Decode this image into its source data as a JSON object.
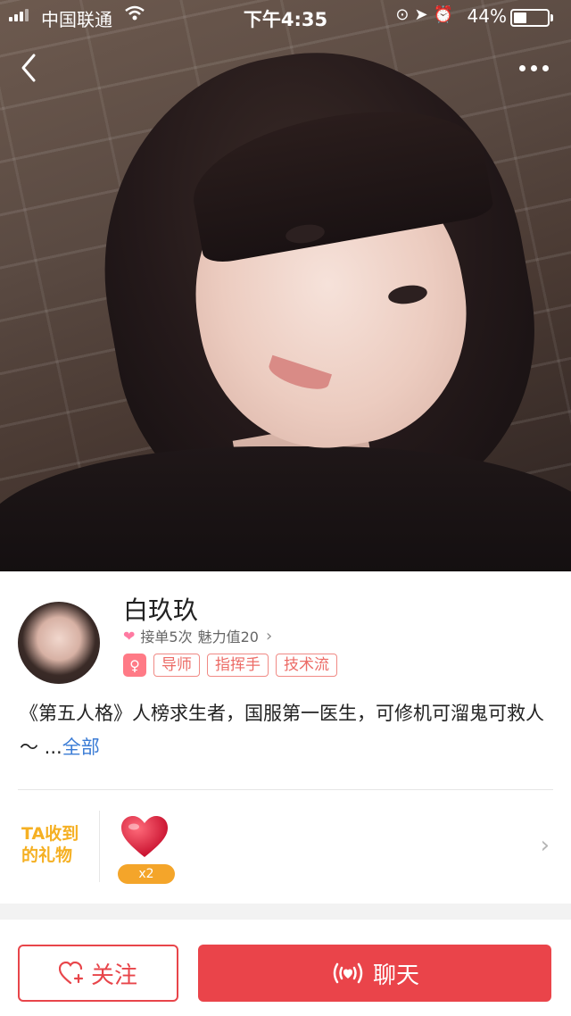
{
  "status_bar": {
    "carrier": "中国联通",
    "time": "下午4:35",
    "battery_pct": "44%",
    "battery_level": 0.44
  },
  "profile": {
    "name": "白玖玖",
    "orders": "接单5次",
    "charm": "魅力值20",
    "gender_icon": "female-icon",
    "tags": [
      "导师",
      "指挥手",
      "技术流"
    ],
    "bio": "《第五人格》人榜求生者，国服第一医生，可修机可溜鬼可救人～ ...",
    "bio_more": "全部"
  },
  "gifts": {
    "title_line1": "TA收到",
    "title_line2": "的礼物",
    "item_icon": "heart-gift-icon",
    "count": "x2"
  },
  "actions": {
    "follow_label": "关注",
    "chat_label": "聊天"
  },
  "colors": {
    "accent": "#ea444a",
    "gift_orange": "#f4a52a",
    "link": "#3a7bd5",
    "tag": "#ec6b66"
  }
}
